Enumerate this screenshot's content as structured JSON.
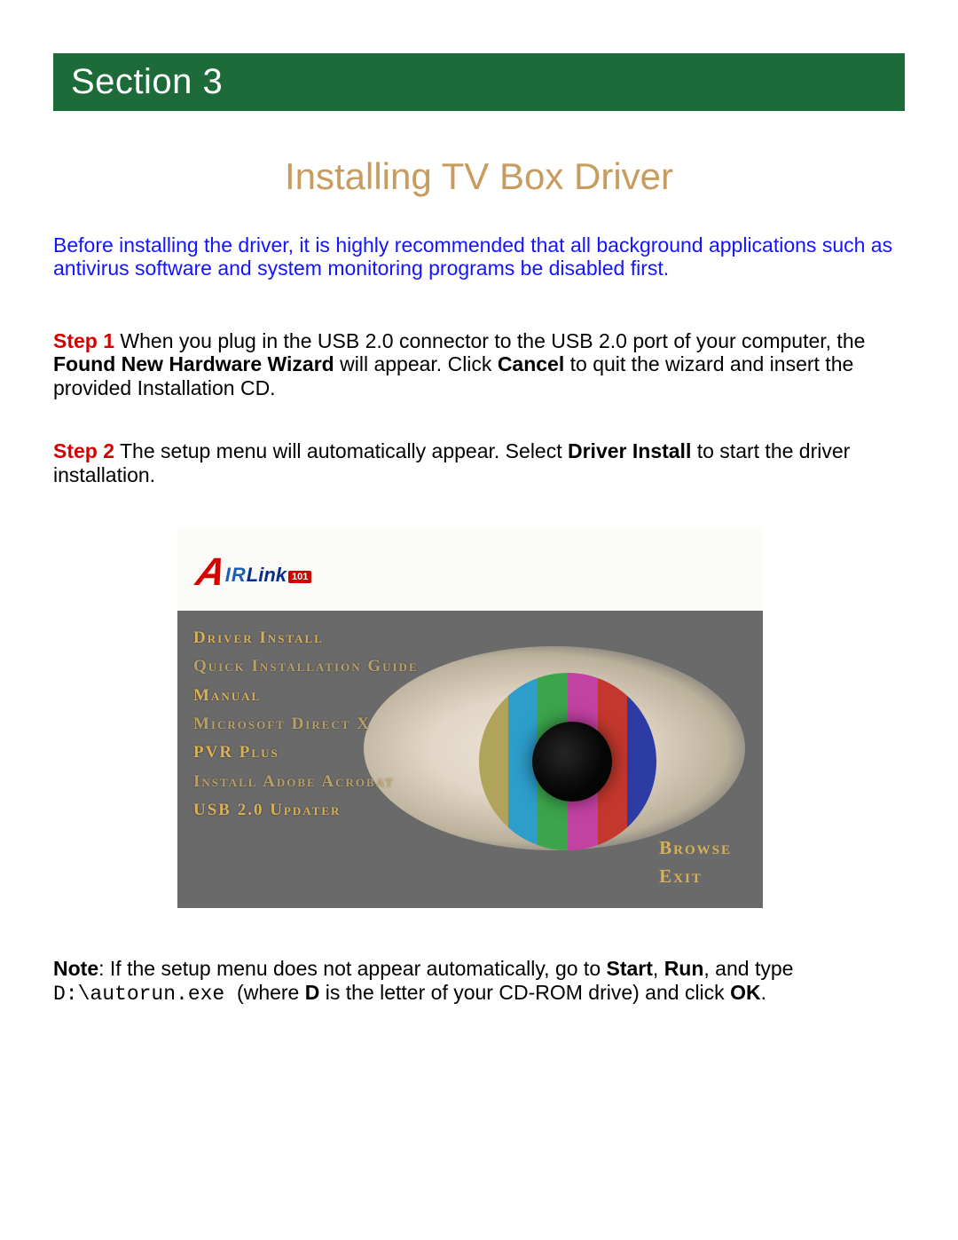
{
  "header": {
    "section_label": "Section 3"
  },
  "title": "Installing TV Box Driver",
  "recommend_text": "Before installing the driver, it is highly recommended that all background applications such as antivirus software and system monitoring programs be disabled first.",
  "steps": {
    "s1": {
      "label": "Step 1",
      "pre": " When you plug in the USB 2.0 connector to the USB 2.0 port of your computer, the ",
      "b1": "Found New Hardware Wizard",
      "mid": " will appear. Click ",
      "b2": "Cancel ",
      "post": "to quit the wizard and insert the provided Installation CD."
    },
    "s2": {
      "label": "Step 2",
      "pre": " The setup menu will automatically appear. Select ",
      "b1": "Driver Install",
      "post": " to start the driver installation."
    }
  },
  "screenshot": {
    "logo": {
      "a": "A",
      "ir": "IR",
      "link": "Link",
      "badge": "101"
    },
    "menu_items": [
      "Driver Install",
      "Quick Installation Guide",
      "Manual",
      "Microsoft Direct X",
      "PVR Plus",
      "Install Adobe Acrobat",
      "USB 2.0 Updater"
    ],
    "side_items": [
      "Browse",
      "Exit"
    ]
  },
  "note": {
    "label": "Note",
    "pre": ": If the setup menu does not appear automatically, go to ",
    "b1": "Start",
    "sep1": ", ",
    "b2": "Run",
    "mid": ", and type ",
    "code": "D:\\autorun.exe ",
    "post1": "(where ",
    "b3": "D",
    "post2": " is the letter of your CD-ROM drive) and click ",
    "b4": "OK",
    "post3": "."
  }
}
